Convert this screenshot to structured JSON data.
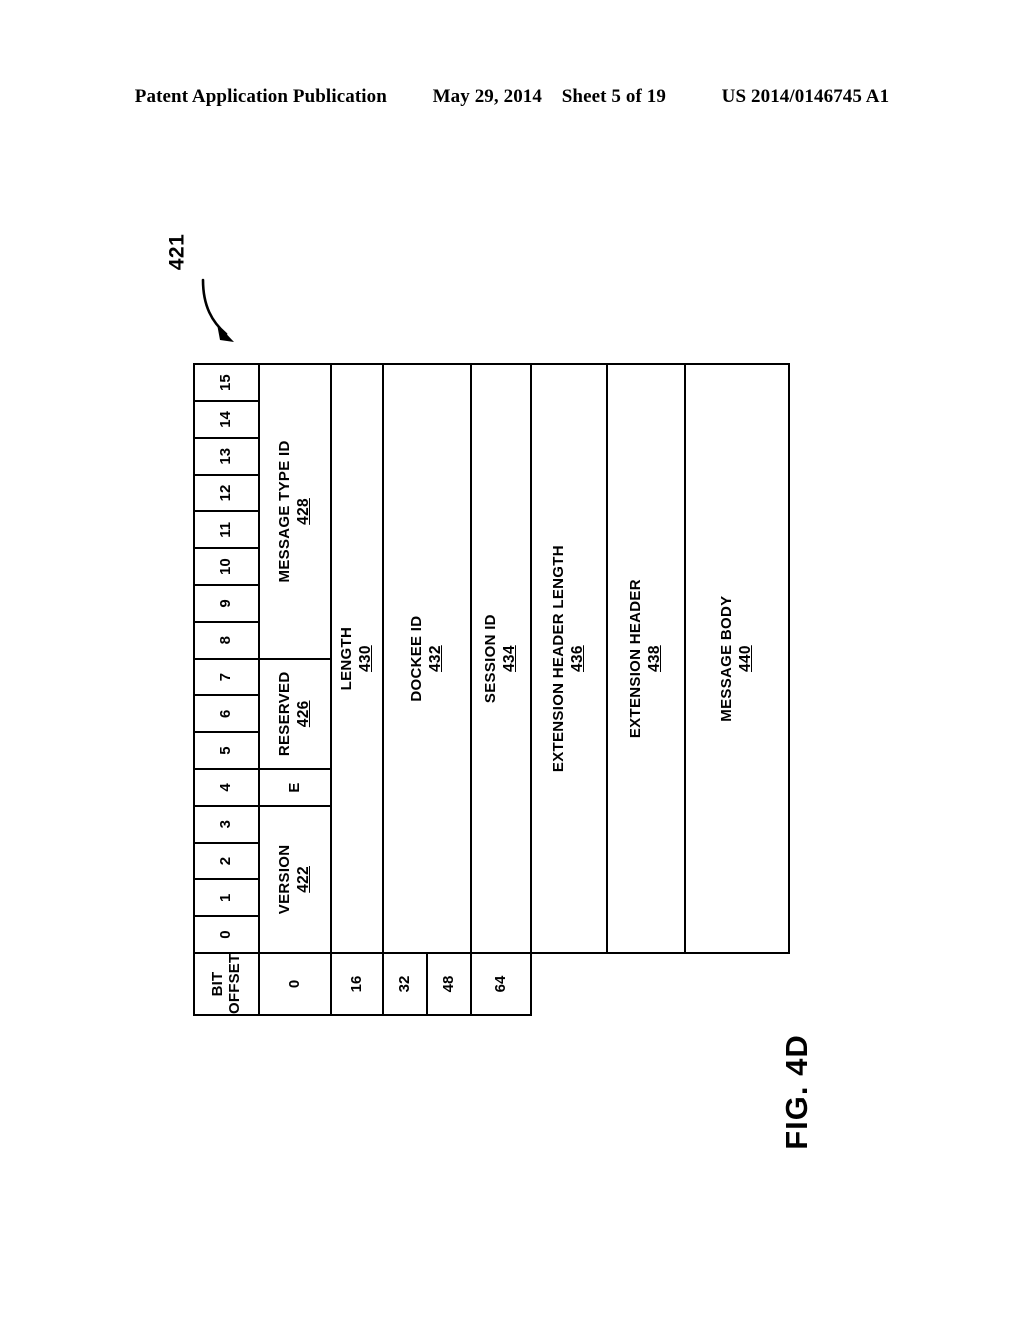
{
  "page_header": {
    "publication": "Patent Application Publication",
    "date": "May 29, 2014",
    "sheet": "Sheet 5 of 19",
    "patent_number": "US 2014/0146745 A1"
  },
  "figure": {
    "caption": "FIG. 4D",
    "callout_reference": "421",
    "offset_column_header_line1": "BIT",
    "offset_column_header_line2": "OFFSET",
    "bit_numbers": [
      "0",
      "1",
      "2",
      "3",
      "4",
      "5",
      "6",
      "7",
      "8",
      "9",
      "10",
      "11",
      "12",
      "13",
      "14",
      "15"
    ],
    "bit_offsets": [
      "0",
      "16",
      "32",
      "48",
      "64"
    ],
    "rows": [
      {
        "offset": "0",
        "fields": [
          {
            "name": "VERSION",
            "ref": "422",
            "bits": "0-3"
          },
          {
            "name": "E",
            "ref": "",
            "bits": "4"
          },
          {
            "name": "RESERVED",
            "ref": "426",
            "bits": "5-7"
          },
          {
            "name": "MESSAGE TYPE ID",
            "ref": "428",
            "bits": "8-15"
          }
        ]
      },
      {
        "offset": "16",
        "fields": [
          {
            "name": "LENGTH",
            "ref": "430",
            "bits": "0-15"
          }
        ]
      },
      {
        "offset": "32",
        "fields": [
          {
            "name": "DOCKEE ID",
            "ref": "432",
            "bits": "0-15"
          }
        ]
      },
      {
        "offset": "48",
        "fields": []
      },
      {
        "offset": "64",
        "fields": [
          {
            "name": "SESSION ID",
            "ref": "434",
            "bits": "0-15"
          }
        ]
      },
      {
        "offset": "",
        "fields": [
          {
            "name": "EXTENSION HEADER LENGTH",
            "ref": "436",
            "bits": "0-15"
          }
        ]
      },
      {
        "offset": "",
        "fields": [
          {
            "name": "EXTENSION HEADER",
            "ref": "438",
            "bits": "0-15"
          }
        ]
      },
      {
        "offset": "",
        "fields": [
          {
            "name": "MESSAGE BODY",
            "ref": "440",
            "bits": "0-15"
          }
        ]
      }
    ]
  }
}
